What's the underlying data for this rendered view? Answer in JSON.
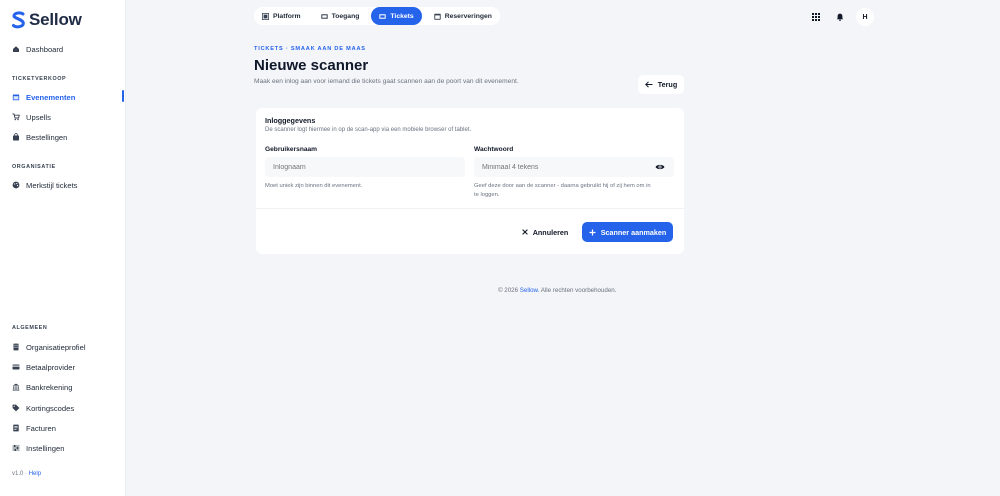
{
  "brand": {
    "name": "Sellow",
    "accent": "#2563eb"
  },
  "sidebar": {
    "dashboard": "Dashboard",
    "section_ticketverkoop": "TICKETVERKOOP",
    "ticket_items": [
      {
        "label": "Evenementen",
        "icon": "calendar-icon",
        "active": true
      },
      {
        "label": "Upsells",
        "icon": "cart-icon"
      },
      {
        "label": "Bestellingen",
        "icon": "bag-icon"
      }
    ],
    "section_organisatie": "ORGANISATIE",
    "org_items": [
      {
        "label": "Merkstijl tickets",
        "icon": "palette-icon"
      }
    ],
    "section_algemeen": "ALGEMEEN",
    "general_items": [
      {
        "label": "Organisatieprofiel",
        "icon": "building-icon"
      },
      {
        "label": "Betaalprovider",
        "icon": "card-icon"
      },
      {
        "label": "Bankrekening",
        "icon": "bank-icon"
      },
      {
        "label": "Kortingscodes",
        "icon": "tag-icon"
      },
      {
        "label": "Facturen",
        "icon": "invoice-icon"
      },
      {
        "label": "Instellingen",
        "icon": "sliders-icon"
      }
    ],
    "version": "v1.0 ·",
    "help": "Help"
  },
  "topnav": {
    "tabs": [
      {
        "label": "Platform",
        "icon": "grid-icon"
      },
      {
        "label": "Toegang",
        "icon": "ticket-icon"
      },
      {
        "label": "Tickets",
        "icon": "ticket-icon",
        "active": true
      },
      {
        "label": "Reserveringen",
        "icon": "calendar-icon"
      }
    ],
    "avatar_initial": "H"
  },
  "header": {
    "eyebrow": "TICKETS · SMAAK AAN DE MAAS",
    "title": "Nieuwe scanner",
    "subtitle": "Maak een inlog aan voor iemand die tickets gaat scannen aan de poort van dit evenement.",
    "back_label": "Terug"
  },
  "form": {
    "section_title": "Inloggegevens",
    "section_desc": "De scanner logt hiermee in op de scan-app via een mobiele browser of tablet.",
    "username_label": "Gebruikersnaam",
    "username_placeholder": "Inlognaam",
    "username_help": "Moet uniek zijn binnen dit evenement.",
    "password_label": "Wachtwoord",
    "password_placeholder": "Minimaal 4 tekens",
    "password_help_1": "Geef deze door aan de scanner - daarna gebruikt hij of zij hem om in",
    "password_help_2": "te loggen.",
    "cancel_label": "Annuleren",
    "submit_label": "Scanner aanmaken"
  },
  "footer": {
    "prefix": "© 2026",
    "brand": "Sellow.",
    "suffix": "Alle rechten voorbehouden."
  }
}
